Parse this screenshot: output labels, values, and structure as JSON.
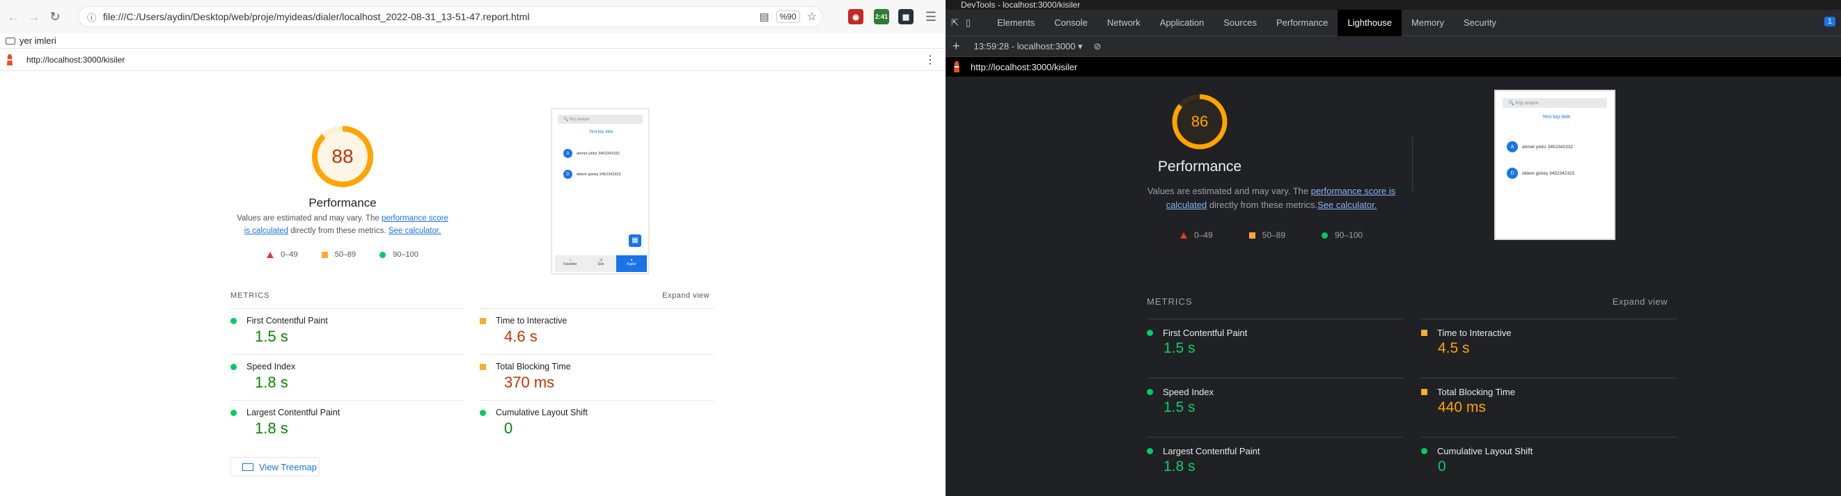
{
  "browser": {
    "url": "file:///C:/Users/aydin/Desktop/web/proje/myideas/dialer/localhost_2022-08-31_13-51-47.report.html",
    "zoom": "%90",
    "ext_badge": "2:41",
    "bookmark_folder": "yer imleri",
    "report_url": "http://localhost:3000/kisiler"
  },
  "left_report": {
    "score": "88",
    "score_value": 88,
    "category": "Performance",
    "desc_prefix": "Values are estimated and may vary. The ",
    "desc_link": "performance score is calculated",
    "desc_mid": " directly from these metrics. ",
    "desc_calc": "See calculator.",
    "legend": [
      "0–49",
      "50–89",
      "90–100"
    ],
    "metrics_label": "METRICS",
    "expand": "Expand view",
    "metrics": [
      {
        "title": "First Contentful Paint",
        "value": "1.5 s",
        "status": "pass"
      },
      {
        "title": "Time to Interactive",
        "value": "4.6 s",
        "status": "average"
      },
      {
        "title": "Speed Index",
        "value": "1.8 s",
        "status": "pass"
      },
      {
        "title": "Total Blocking Time",
        "value": "370 ms",
        "status": "average"
      },
      {
        "title": "Largest Contentful Paint",
        "value": "1.8 s",
        "status": "pass"
      },
      {
        "title": "Cumulative Layout Shift",
        "value": "0",
        "status": "pass"
      }
    ],
    "treemap": "View Treemap"
  },
  "thumbnail": {
    "search_placeholder": "Kişi arayın",
    "add_contact": "Yeni kişi ekle",
    "contacts": [
      {
        "initial": "A",
        "label": "ahmet yıldız 3452342332"
      },
      {
        "initial": "D",
        "label": "didem güneş 3452342323"
      }
    ],
    "tabs": [
      "Favoriler",
      "Son",
      "Kişiler"
    ]
  },
  "devtools": {
    "window_title": "DevTools - localhost:3000/kisiler",
    "tabs": [
      "Elements",
      "Console",
      "Network",
      "Application",
      "Sources",
      "Performance",
      "Lighthouse",
      "Memory",
      "Security"
    ],
    "active_tab": "Lighthouse",
    "issues_badge": "1",
    "report_select": "13:59:28 - localhost:3000",
    "report_url": "http://localhost:3000/kisiler"
  },
  "right_report": {
    "score": "86",
    "score_value": 86,
    "category": "Performance",
    "desc_prefix": "Values are estimated and may vary. The ",
    "desc_link": "performance score is calculated",
    "desc_mid": " directly from these metrics.",
    "desc_calc": "See calculator.",
    "legend": [
      "0–49",
      "50–89",
      "90–100"
    ],
    "metrics_label": "METRICS",
    "expand": "Expand view",
    "metrics": [
      {
        "title": "First Contentful Paint",
        "value": "1.5 s",
        "status": "pass"
      },
      {
        "title": "Time to Interactive",
        "value": "4.5 s",
        "status": "average"
      },
      {
        "title": "Speed Index",
        "value": "1.5 s",
        "status": "pass"
      },
      {
        "title": "Total Blocking Time",
        "value": "440 ms",
        "status": "average"
      },
      {
        "title": "Largest Contentful Paint",
        "value": "1.8 s",
        "status": "pass"
      },
      {
        "title": "Cumulative Layout Shift",
        "value": "0",
        "status": "pass"
      }
    ]
  },
  "colors": {
    "pass": "#0cce6b",
    "pass_text_light": "#008800",
    "average": "#ffa400",
    "average_text_light": "#c33300",
    "fail": "#ff4e42",
    "link_light": "#1a73e8",
    "link_dark": "#8ab4f8"
  }
}
